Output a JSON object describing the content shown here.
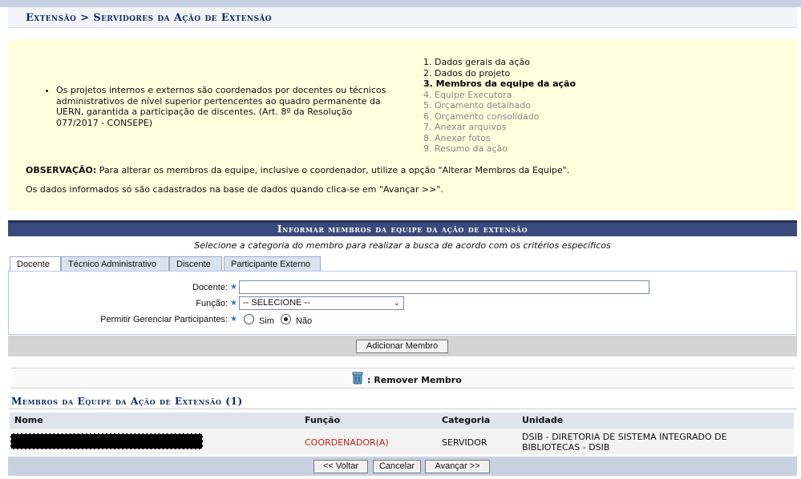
{
  "breadcrumb": "Extensão > Servidores da Ação de Extensão",
  "info": {
    "bullet": "Os projetos internos e externos são coordenados por docentes ou técnicos administrativos de nível superior pertencentes ao quadro permanente da UERN, garantida a participação de discentes. (Art. 8º da Resolução 077/2017 - CONSEPE)",
    "steps": [
      {
        "label": "1. Dados gerais da ação",
        "state": "done"
      },
      {
        "label": "2. Dados do projeto",
        "state": "done"
      },
      {
        "label": "3. Membros da equipe da ação",
        "state": "current"
      },
      {
        "label": "4. Equipe Executora",
        "state": "pending"
      },
      {
        "label": "5. Orçamento detalhado",
        "state": "pending"
      },
      {
        "label": "6. Orçamento consolidado",
        "state": "pending"
      },
      {
        "label": "7. Anexar arquivos",
        "state": "pending"
      },
      {
        "label": "8. Anexar fotos",
        "state": "pending"
      },
      {
        "label": "9. Resumo da ação",
        "state": "pending"
      }
    ],
    "obs_label": "OBSERVAÇÃO:",
    "obs_text": " Para alterar os membros da equipe, inclusive o coordenador, utilize a opção \"Alterar Membros da Equipe\".",
    "note": "Os dados informados só são cadastrados na base de dados quando clica-se em \"Avançar >>\"."
  },
  "form": {
    "section_title": "Informar membros da equipe da ação de extensão",
    "subtitle": "Selecione a categoria do membro para realizar a busca de acordo com os critérios específicos",
    "tabs": [
      "Docente",
      "Técnico Administrativo",
      "Discente",
      "Participante Externo"
    ],
    "docente_label": "Docente:",
    "docente_value": "",
    "funcao_label": "Função:",
    "funcao_value": "-- SELECIONE --",
    "gerenciar_label": "Permitir Gerenciar Participantes:",
    "radio_sim": "Sim",
    "radio_nao": "Não",
    "radio_selected": "Não",
    "add_button": "Adicionar Membro"
  },
  "legend": {
    "remove_label": ": Remover Membro",
    "icon": "trash-icon"
  },
  "members": {
    "title": "Membros da Equipe da Ação de Extensão (1)",
    "columns": [
      "Nome",
      "Função",
      "Categoria",
      "Unidade"
    ],
    "rows": [
      {
        "nome": "",
        "funcao": "COORDENADOR(A)",
        "categoria": "SERVIDOR",
        "unidade_line1": "DSIB - DIRETORIA DE SISTEMA INTEGRADO DE",
        "unidade_line2": "BIBLIOTECAS - DSIB"
      }
    ]
  },
  "footer": {
    "voltar": "<< Voltar",
    "cancelar": "Cancelar",
    "avancar": "Avançar >>"
  },
  "colors": {
    "header": "#3b4a7c",
    "info_bg": "#ffffdd",
    "breadcrumb": "#0c2a6a",
    "coordenador": "#c0201f"
  }
}
